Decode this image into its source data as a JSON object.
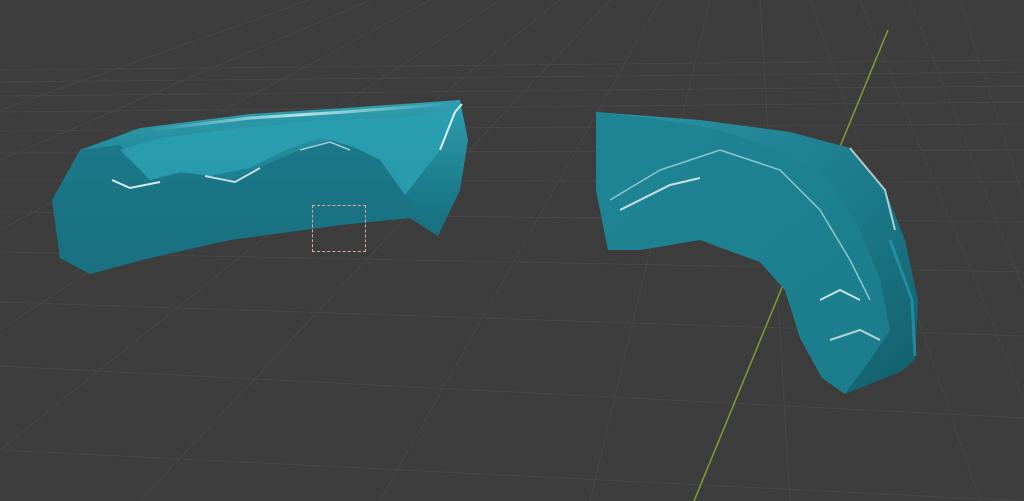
{
  "viewport": {
    "background_color": "#3d3d3d",
    "grid_color": "#4a4a4a",
    "y_axis_color": "#7f9e2f",
    "object_color": "#1f7f8f",
    "selection_box_color": "#e8a0a0"
  },
  "objects": [
    {
      "name": "mesh-object-left",
      "material": "glossy-teal"
    },
    {
      "name": "mesh-object-right",
      "material": "glossy-teal"
    }
  ],
  "tool": {
    "icon": "box-select-icon",
    "state": "active"
  }
}
